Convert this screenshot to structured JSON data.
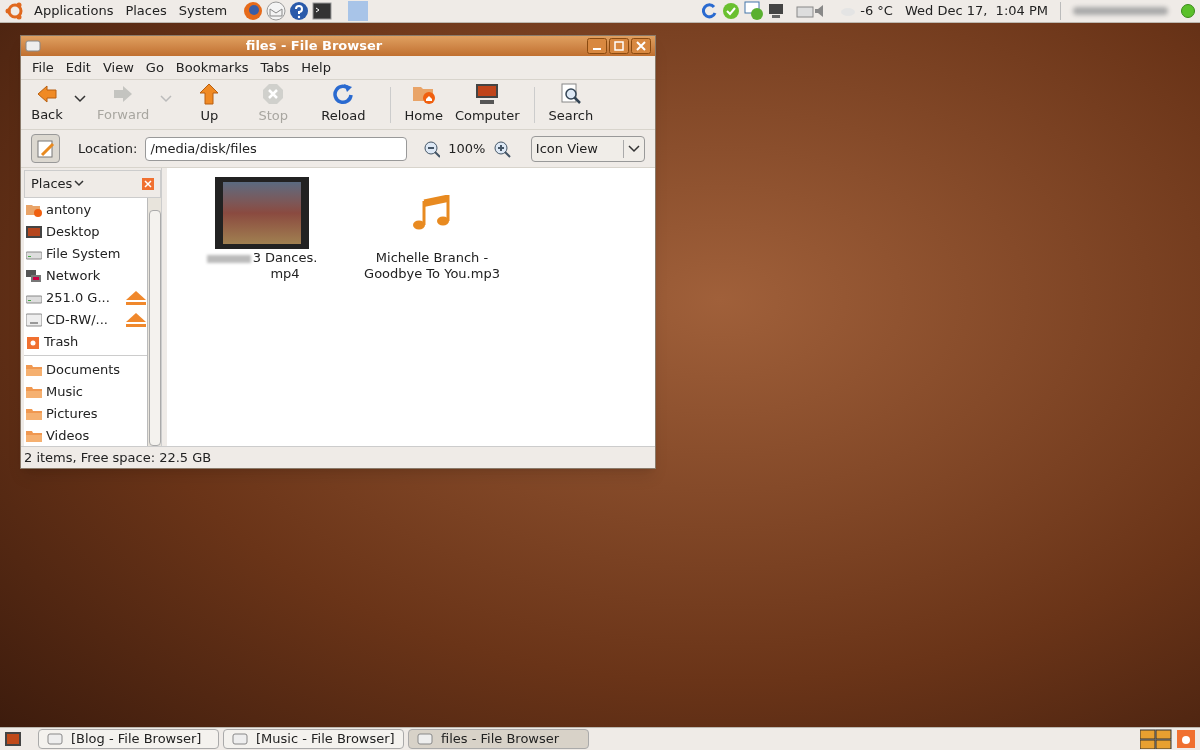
{
  "top_panel": {
    "menus": [
      "Applications",
      "Places",
      "System"
    ],
    "weather": "-6 °C",
    "clock": "Wed Dec 17,  1:04 PM"
  },
  "window": {
    "title": "files - File Browser",
    "menu": [
      "File",
      "Edit",
      "View",
      "Go",
      "Bookmarks",
      "Tabs",
      "Help"
    ],
    "toolbar": [
      [
        {
          "label": "Back",
          "disabled": false,
          "dropdown": true,
          "kind": "back"
        },
        {
          "label": "Forward",
          "disabled": true,
          "dropdown": true,
          "kind": "forward"
        },
        {
          "label": "Up",
          "disabled": false,
          "dropdown": false,
          "kind": "up"
        },
        {
          "label": "Stop",
          "disabled": true,
          "dropdown": false,
          "kind": "stop"
        },
        {
          "label": "Reload",
          "disabled": false,
          "dropdown": false,
          "kind": "reload"
        }
      ],
      [
        {
          "label": "Home",
          "disabled": false,
          "dropdown": false,
          "kind": "home"
        },
        {
          "label": "Computer",
          "disabled": false,
          "dropdown": false,
          "kind": "computer"
        }
      ],
      [
        {
          "label": "Search",
          "disabled": false,
          "dropdown": false,
          "kind": "search"
        }
      ]
    ],
    "location": {
      "label": "Location:",
      "value": "/media/disk/files",
      "zoom": "100%",
      "view": "Icon View"
    },
    "sidebar": {
      "title": "Places",
      "sections": [
        [
          {
            "label": "antony",
            "kind": "home",
            "eject": false
          },
          {
            "label": "Desktop",
            "kind": "desktop",
            "eject": false
          },
          {
            "label": "File System",
            "kind": "drive",
            "eject": false
          },
          {
            "label": "Network",
            "kind": "network",
            "eject": false
          },
          {
            "label": "251.0 G...",
            "kind": "drive",
            "eject": true
          },
          {
            "label": "CD-RW/...",
            "kind": "cdrom",
            "eject": true
          },
          {
            "label": "Trash",
            "kind": "trash",
            "eject": false
          }
        ],
        [
          {
            "label": "Documents",
            "kind": "folder",
            "eject": false
          },
          {
            "label": "Music",
            "kind": "folder",
            "eject": false
          },
          {
            "label": "Pictures",
            "kind": "folder",
            "eject": false
          },
          {
            "label": "Videos",
            "kind": "folder",
            "eject": false
          }
        ]
      ]
    },
    "files": [
      {
        "kind": "video",
        "name_lines": [
          "3 Dances.",
          "mp4"
        ]
      },
      {
        "kind": "audio",
        "name_lines": [
          "Michelle Branch -",
          "Goodbye To You.mp3"
        ]
      }
    ],
    "status": "2 items, Free space: 22.5 GB"
  },
  "taskbar": [
    {
      "label": "[Blog - File Browser]",
      "selected": false
    },
    {
      "label": "[Music - File Browser]",
      "selected": false
    },
    {
      "label": "files - File Browser",
      "selected": true
    }
  ]
}
